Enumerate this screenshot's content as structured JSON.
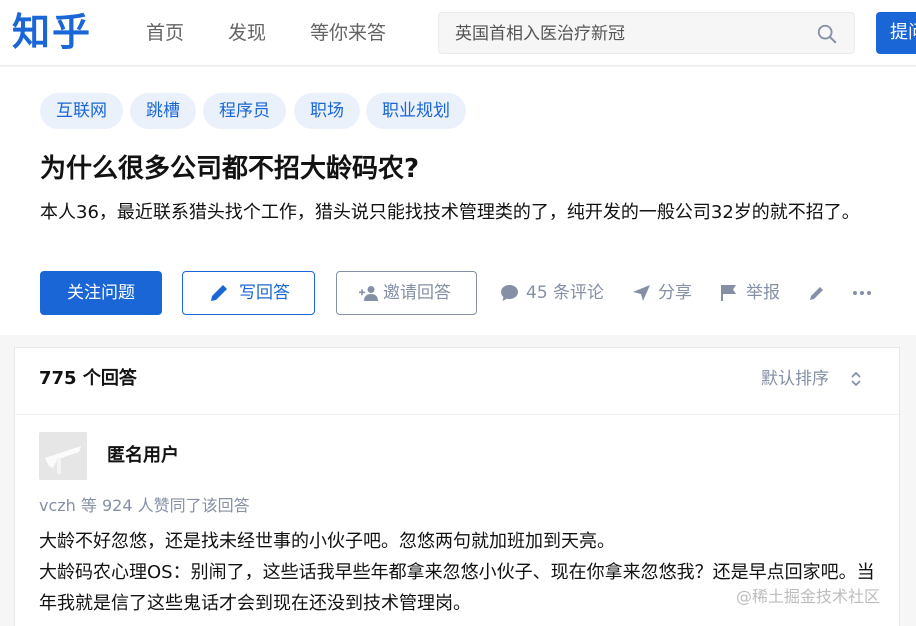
{
  "header": {
    "logo": "知乎",
    "nav": [
      "首页",
      "发现",
      "等你来答"
    ],
    "search_value": "英国首相入医治疗新冠",
    "ask_label": "提问"
  },
  "question": {
    "tags": [
      "互联网",
      "跳槽",
      "程序员",
      "职场",
      "职业规划"
    ],
    "title": "为什么很多公司都不招大龄码农?",
    "description": "本人36，最近联系猎头找个工作，猎头说只能找技术管理类的了，纯开发的一般公司32岁的就不招了。",
    "follow_label": "关注问题",
    "write_label": "写回答",
    "invite_label": "邀请回答",
    "comments_label": "45 条评论",
    "share_label": "分享",
    "report_label": "举报"
  },
  "answers": {
    "count_label": "775 个回答",
    "sort_label": "默认排序",
    "first": {
      "author": "匿名用户",
      "voters": "vczh 等 924 人赞同了该回答",
      "lines": [
        "大龄不好忽悠，还是找未经世事的小伙子吧。忽悠两句就加班加到天亮。",
        "大龄码农心理OS：别闹了，这些话我早些年都拿来忽悠小伙子、现在你拿来忽悠我？还是早点回家吧。当年我就是信了这些鬼话才会到现在还没到技术管理岗。"
      ]
    }
  },
  "watermark": "@稀土掘金技术社区",
  "colors": {
    "brand": "#1a66d6",
    "muted": "#8590a6",
    "tag_bg": "#ebf1fb"
  }
}
